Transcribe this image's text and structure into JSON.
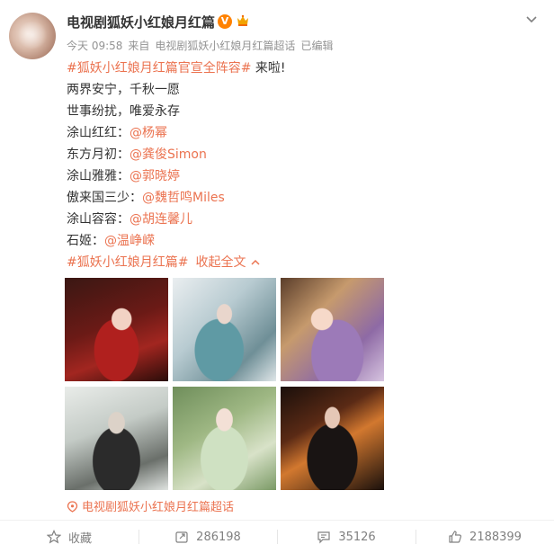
{
  "post": {
    "username": "电视剧狐妖小红娘月红篇",
    "verified_badge": "V",
    "time": "今天 09:58",
    "source_prefix": "来自",
    "source": "电视剧狐妖小红娘月红篇超话",
    "edited": "已编辑",
    "content": {
      "line1_tag": "#狐妖小红娘月红篇官宣全阵容#",
      "line1_tail": " 来啦!",
      "line2": "两界安宁，千秋一愿",
      "line3": "世事纷扰，唯爱永存",
      "roles": [
        {
          "role": "涂山红红：",
          "actor": "@杨幂"
        },
        {
          "role": "东方月初：",
          "actor": "@龚俊Simon"
        },
        {
          "role": "涂山雅雅：",
          "actor": "@郭晓婷"
        },
        {
          "role": "傲来国三少：",
          "actor": "@魏哲鸣Miles"
        },
        {
          "role": "涂山容容：",
          "actor": "@胡连馨儿"
        },
        {
          "role": "石姬：",
          "actor": "@温峥嵘"
        }
      ],
      "bottom_tag": "#狐妖小红娘月红篇#",
      "collapse_label": "收起全文"
    },
    "supertopic": "电视剧狐妖小红娘月红篇超话"
  },
  "actions": {
    "favorite": "收藏",
    "repost_count": "286198",
    "comment_count": "35126",
    "like_count": "2188399"
  },
  "icons": {
    "verified": "verified-v-icon",
    "vip": "vip-crown-icon",
    "menu": "chevron-down-icon",
    "collapse": "chevron-up-icon",
    "supertopic": "supertopic-icon",
    "favorite": "star-icon",
    "repost": "repost-icon",
    "comment": "comment-icon",
    "like": "thumb-up-icon"
  },
  "colors": {
    "link": "#eb7350",
    "verified": "#ff8200",
    "meta": "#939393"
  }
}
